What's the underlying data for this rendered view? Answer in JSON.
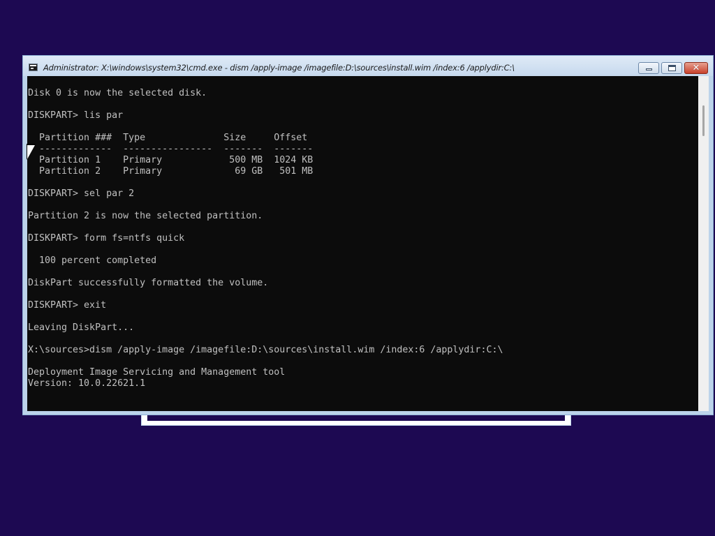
{
  "window": {
    "title": "Administrator: X:\\windows\\system32\\cmd.exe - dism  /apply-image /imagefile:D:\\sources\\install.wim /index:6 /applydir:C:\\",
    "minimize_label": "",
    "maximize_label": "",
    "close_label": "✕"
  },
  "console": {
    "lines": [
      "Disk 0 is now the selected disk.",
      "",
      "DISKPART> lis par",
      "",
      "  Partition ###  Type              Size     Offset",
      "  -------------  ----------------  -------  -------",
      "  Partition 1    Primary            500 MB  1024 KB",
      "  Partition 2    Primary             69 GB   501 MB",
      "",
      "DISKPART> sel par 2",
      "",
      "Partition 2 is now the selected partition.",
      "",
      "DISKPART> form fs=ntfs quick",
      "",
      "  100 percent completed",
      "",
      "DiskPart successfully formatted the volume.",
      "",
      "DISKPART> exit",
      "",
      "Leaving DiskPart...",
      "",
      "X:\\sources>dism /apply-image /imagefile:D:\\sources\\install.wim /index:6 /applydir:C:\\",
      "",
      "Deployment Image Servicing and Management tool",
      "Version: 10.0.22621.1"
    ],
    "text_color": "#c0c0c0",
    "background_color": "#0c0c0c"
  },
  "colors": {
    "desktop": "#1d0952",
    "window_frame": "#bcd3ea",
    "close_button": "#c8412c"
  }
}
